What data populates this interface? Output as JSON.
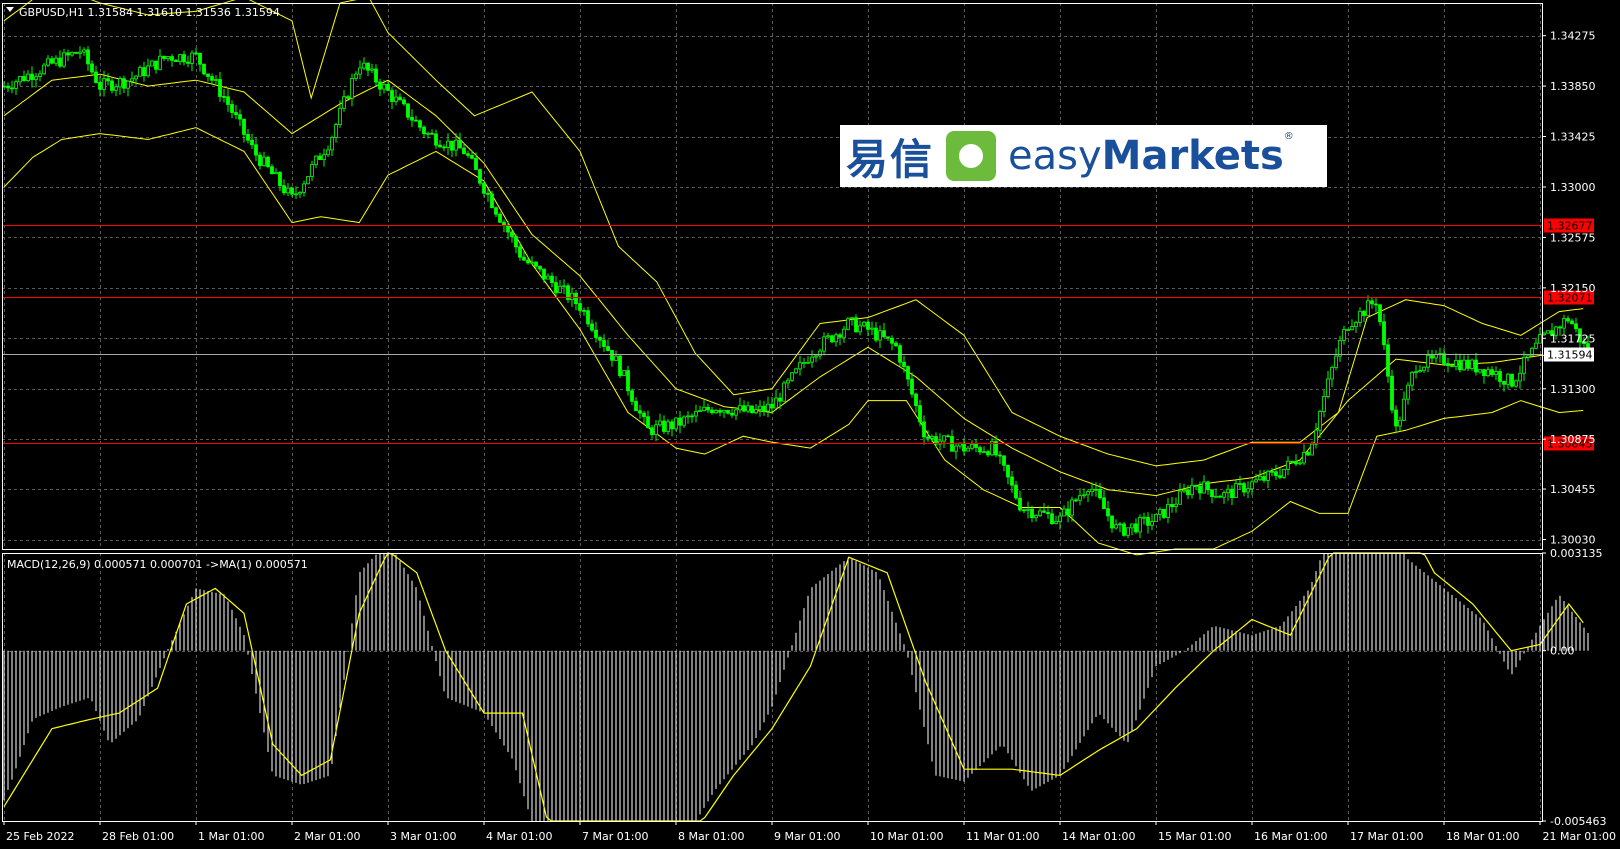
{
  "header": {
    "symbol_text": "GBPUSD,H1  1.31584 1.31610 1.31536 1.31594",
    "macd_text": "MACD(12,26,9) 0.000571 0.000701  ->MA(1) 0.000571"
  },
  "logo": {
    "cn": "易信",
    "en_light": "easy",
    "en_bold": "Markets",
    "reg": "®"
  },
  "colors": {
    "background": "#000000",
    "grid": "#5a5a5a",
    "candle_up": "#00ff00",
    "bollinger": "#ffff00",
    "level_line": "#ff0000",
    "price_line": "#aaaaaa",
    "macd_hist": "#ffffff",
    "macd_signal": "#ffff00"
  },
  "chart_data": [
    {
      "type": "line",
      "title": "GBPUSD,H1",
      "ylim": [
        1.2995,
        1.3455
      ],
      "y_ticks": [
        "1.34275",
        "1.33850",
        "1.33425",
        "1.33000",
        "1.32575",
        "1.32150",
        "1.31725",
        "1.31300",
        "1.30875",
        "1.30455",
        "1.30030"
      ],
      "x_ticks": [
        "25 Feb 2022",
        "28 Feb 01:00",
        "1 Mar 01:00",
        "2 Mar 01:00",
        "3 Mar 01:00",
        "4 Mar 01:00",
        "7 Mar 01:00",
        "8 Mar 01:00",
        "9 Mar 01:00",
        "10 Mar 01:00",
        "11 Mar 01:00",
        "14 Mar 01:00",
        "15 Mar 01:00",
        "16 Mar 01:00",
        "17 Mar 01:00",
        "18 Mar 01:00",
        "21 Mar 01:00"
      ],
      "price_anchors": [
        [
          0,
          1.3385
        ],
        [
          0.8,
          1.3415
        ],
        [
          1,
          1.3385
        ],
        [
          1.3,
          1.339
        ],
        [
          1.7,
          1.341
        ],
        [
          2,
          1.341
        ],
        [
          2.3,
          1.3375
        ],
        [
          2.6,
          1.333
        ],
        [
          3,
          1.329
        ],
        [
          3.4,
          1.334
        ],
        [
          3.7,
          1.3405
        ],
        [
          4,
          1.338
        ],
        [
          4.4,
          1.3345
        ],
        [
          4.8,
          1.333
        ],
        [
          5,
          1.33
        ],
        [
          5.4,
          1.324
        ],
        [
          6,
          1.32
        ],
        [
          6.4,
          1.315
        ],
        [
          6.7,
          1.3095
        ],
        [
          7,
          1.31
        ],
        [
          7.4,
          1.3115
        ],
        [
          7.8,
          1.311
        ],
        [
          8,
          1.3115
        ],
        [
          8.4,
          1.316
        ],
        [
          8.8,
          1.3185
        ],
        [
          9,
          1.318
        ],
        [
          9.3,
          1.3165
        ],
        [
          9.6,
          1.309
        ],
        [
          10,
          1.308
        ],
        [
          10.3,
          1.308
        ],
        [
          10.6,
          1.303
        ],
        [
          11,
          1.302
        ],
        [
          11.3,
          1.305
        ],
        [
          11.6,
          1.301
        ],
        [
          12,
          1.302
        ],
        [
          12.4,
          1.305
        ],
        [
          12.7,
          1.304
        ],
        [
          13,
          1.305
        ],
        [
          13.3,
          1.306
        ],
        [
          13.6,
          1.308
        ],
        [
          13.9,
          1.3165
        ],
        [
          14,
          1.3185
        ],
        [
          14.3,
          1.3205
        ],
        [
          14.5,
          1.3095
        ],
        [
          14.7,
          1.315
        ],
        [
          15,
          1.3155
        ],
        [
          15.5,
          1.3145
        ],
        [
          15.7,
          1.3135
        ],
        [
          16,
          1.317
        ],
        [
          16.3,
          1.319
        ],
        [
          16.5,
          1.31594
        ]
      ],
      "bollinger_upper": [
        [
          0,
          1.344
        ],
        [
          0.5,
          1.347
        ],
        [
          1,
          1.3455
        ],
        [
          1.5,
          1.3445
        ],
        [
          2,
          1.3448
        ],
        [
          2.5,
          1.346
        ],
        [
          3,
          1.344
        ],
        [
          3.2,
          1.3375
        ],
        [
          3.5,
          1.3455
        ],
        [
          3.8,
          1.346
        ],
        [
          4,
          1.343
        ],
        [
          4.5,
          1.339
        ],
        [
          4.9,
          1.336
        ],
        [
          5.5,
          1.338
        ],
        [
          6,
          1.333
        ],
        [
          6.4,
          1.325
        ],
        [
          6.8,
          1.322
        ],
        [
          7.2,
          1.316
        ],
        [
          7.6,
          1.3125
        ],
        [
          8,
          1.313
        ],
        [
          8.5,
          1.3185
        ],
        [
          9,
          1.319
        ],
        [
          9.5,
          1.3205
        ],
        [
          10,
          1.3175
        ],
        [
          10.5,
          1.311
        ],
        [
          11,
          1.309
        ],
        [
          11.5,
          1.3075
        ],
        [
          12,
          1.3065
        ],
        [
          12.5,
          1.307
        ],
        [
          13,
          1.3085
        ],
        [
          13.5,
          1.3085
        ],
        [
          13.9,
          1.311
        ],
        [
          14.2,
          1.319
        ],
        [
          14.6,
          1.3205
        ],
        [
          15,
          1.32
        ],
        [
          15.4,
          1.3185
        ],
        [
          15.8,
          1.3175
        ],
        [
          16.2,
          1.3195
        ],
        [
          16.5,
          1.3198
        ]
      ],
      "bollinger_middle": [
        [
          0,
          1.336
        ],
        [
          0.5,
          1.339
        ],
        [
          1,
          1.3395
        ],
        [
          1.5,
          1.3385
        ],
        [
          2,
          1.339
        ],
        [
          2.5,
          1.338
        ],
        [
          3,
          1.3345
        ],
        [
          3.5,
          1.337
        ],
        [
          4,
          1.339
        ],
        [
          4.5,
          1.336
        ],
        [
          5,
          1.332
        ],
        [
          5.5,
          1.326
        ],
        [
          6,
          1.3225
        ],
        [
          6.5,
          1.3175
        ],
        [
          7,
          1.313
        ],
        [
          7.5,
          1.3115
        ],
        [
          8,
          1.311
        ],
        [
          8.5,
          1.314
        ],
        [
          9,
          1.3165
        ],
        [
          9.5,
          1.314
        ],
        [
          10,
          1.3105
        ],
        [
          10.5,
          1.308
        ],
        [
          11,
          1.306
        ],
        [
          11.5,
          1.3045
        ],
        [
          12,
          1.304
        ],
        [
          12.5,
          1.305
        ],
        [
          13,
          1.3055
        ],
        [
          13.5,
          1.307
        ],
        [
          14,
          1.312
        ],
        [
          14.5,
          1.3155
        ],
        [
          15,
          1.315
        ],
        [
          15.5,
          1.3152
        ],
        [
          16,
          1.3158
        ],
        [
          16.5,
          1.316
        ]
      ],
      "bollinger_lower": [
        [
          0,
          1.33
        ],
        [
          0.3,
          1.3325
        ],
        [
          0.6,
          1.334
        ],
        [
          1,
          1.3345
        ],
        [
          1.5,
          1.334
        ],
        [
          2,
          1.335
        ],
        [
          2.5,
          1.333
        ],
        [
          3,
          1.327
        ],
        [
          3.3,
          1.3275
        ],
        [
          3.7,
          1.327
        ],
        [
          4,
          1.331
        ],
        [
          4.5,
          1.333
        ],
        [
          5,
          1.3305
        ],
        [
          5.5,
          1.3235
        ],
        [
          6,
          1.318
        ],
        [
          6.5,
          1.311
        ],
        [
          7,
          1.308
        ],
        [
          7.3,
          1.3075
        ],
        [
          7.7,
          1.309
        ],
        [
          8,
          1.3085
        ],
        [
          8.4,
          1.308
        ],
        [
          8.8,
          1.31
        ],
        [
          9,
          1.312
        ],
        [
          9.4,
          1.312
        ],
        [
          9.8,
          1.307
        ],
        [
          10.2,
          1.3045
        ],
        [
          10.6,
          1.303
        ],
        [
          11,
          1.303
        ],
        [
          11.4,
          1.3
        ],
        [
          11.8,
          1.299
        ],
        [
          12.2,
          1.2995
        ],
        [
          12.6,
          1.2995
        ],
        [
          13,
          1.301
        ],
        [
          13.4,
          1.3035
        ],
        [
          13.7,
          1.3025
        ],
        [
          14,
          1.3025
        ],
        [
          14.3,
          1.309
        ],
        [
          14.6,
          1.3095
        ],
        [
          15,
          1.3105
        ],
        [
          15.5,
          1.311
        ],
        [
          15.8,
          1.312
        ],
        [
          16.2,
          1.311
        ],
        [
          16.5,
          1.3112
        ]
      ],
      "level_lines": [
        1.32677,
        1.32071,
        1.30845
      ],
      "level_labels": [
        "1.32677",
        "1.32071",
        "1.30845"
      ],
      "current_price": 1.31594,
      "current_price_label": "1.31594"
    },
    {
      "type": "bar",
      "title": "MACD(12,26,9)",
      "ylim": [
        -0.005463,
        0.003135
      ],
      "y_ticks": [
        "0.003135",
        "0.00",
        "-0.005463"
      ],
      "histogram_anchors": [
        [
          0,
          -0.0048
        ],
        [
          0.1,
          -0.004
        ],
        [
          0.3,
          -0.0022
        ],
        [
          0.6,
          -0.0018
        ],
        [
          0.9,
          -0.0015
        ],
        [
          1.1,
          -0.003
        ],
        [
          1.4,
          -0.0022
        ],
        [
          1.7,
          0.0
        ],
        [
          2,
          0.002
        ],
        [
          2.3,
          0.0018
        ],
        [
          2.5,
          0.0005
        ],
        [
          2.8,
          -0.004
        ],
        [
          3.1,
          -0.0043
        ],
        [
          3.4,
          -0.004
        ],
        [
          3.7,
          0.0025
        ],
        [
          4,
          0.0035
        ],
        [
          4.3,
          0.002
        ],
        [
          4.6,
          -0.0015
        ],
        [
          5,
          -0.002
        ],
        [
          5.3,
          -0.0035
        ],
        [
          5.6,
          -0.0065
        ],
        [
          6,
          -0.0065
        ],
        [
          6.4,
          -0.0055
        ],
        [
          6.8,
          -0.007
        ],
        [
          7,
          -0.0065
        ],
        [
          7.4,
          -0.0045
        ],
        [
          7.8,
          -0.003
        ],
        [
          8,
          -0.0018
        ],
        [
          8.4,
          0.002
        ],
        [
          8.8,
          0.003
        ],
        [
          9.1,
          0.0025
        ],
        [
          9.4,
          0.0
        ],
        [
          9.7,
          -0.004
        ],
        [
          10,
          -0.0042
        ],
        [
          10.4,
          -0.003
        ],
        [
          10.7,
          -0.0045
        ],
        [
          11,
          -0.004
        ],
        [
          11.4,
          -0.002
        ],
        [
          11.7,
          -0.003
        ],
        [
          12,
          -0.0005
        ],
        [
          12.3,
          0.0
        ],
        [
          12.6,
          0.0008
        ],
        [
          13,
          0.0005
        ],
        [
          13.3,
          0.0008
        ],
        [
          13.6,
          0.002
        ],
        [
          13.9,
          0.0045
        ],
        [
          14,
          0.005
        ],
        [
          14.2,
          0.0052
        ],
        [
          14.4,
          0.005
        ],
        [
          14.6,
          0.003
        ],
        [
          15,
          0.002
        ],
        [
          15.4,
          0.001
        ],
        [
          15.7,
          -0.0008
        ],
        [
          16,
          0.0008
        ],
        [
          16.2,
          0.0018
        ],
        [
          16.5,
          0.00057
        ]
      ],
      "signal_anchors": [
        [
          0,
          -0.005
        ],
        [
          0.2,
          -0.004
        ],
        [
          0.5,
          -0.0025
        ],
        [
          0.9,
          -0.0022
        ],
        [
          1.2,
          -0.002
        ],
        [
          1.6,
          -0.0012
        ],
        [
          1.9,
          0.0015
        ],
        [
          2.2,
          0.002
        ],
        [
          2.5,
          0.0012
        ],
        [
          2.8,
          -0.003
        ],
        [
          3.1,
          -0.004
        ],
        [
          3.4,
          -0.0035
        ],
        [
          3.7,
          0.0012
        ],
        [
          4,
          0.0032
        ],
        [
          4.3,
          0.0025
        ],
        [
          4.6,
          0.0
        ],
        [
          5,
          -0.002
        ],
        [
          5.4,
          -0.002
        ],
        [
          5.7,
          -0.006
        ],
        [
          6,
          -0.0065
        ],
        [
          6.4,
          -0.006
        ],
        [
          6.8,
          -0.0068
        ],
        [
          7.2,
          -0.0058
        ],
        [
          7.6,
          -0.004
        ],
        [
          8,
          -0.0025
        ],
        [
          8.4,
          -0.0005
        ],
        [
          8.8,
          0.003
        ],
        [
          9.2,
          0.0025
        ],
        [
          9.6,
          -0.001
        ],
        [
          10,
          -0.0038
        ],
        [
          10.5,
          -0.0038
        ],
        [
          11,
          -0.004
        ],
        [
          11.4,
          -0.0032
        ],
        [
          11.8,
          -0.0025
        ],
        [
          12.2,
          -0.0012
        ],
        [
          12.6,
          0.0
        ],
        [
          13,
          0.001
        ],
        [
          13.4,
          0.0005
        ],
        [
          13.8,
          0.003
        ],
        [
          14.2,
          0.005
        ],
        [
          14.5,
          0.0048
        ],
        [
          14.9,
          0.0025
        ],
        [
          15.3,
          0.0015
        ],
        [
          15.7,
          0.0
        ],
        [
          16,
          0.0002
        ],
        [
          16.3,
          0.0015
        ],
        [
          16.5,
          0.0007
        ]
      ]
    }
  ]
}
